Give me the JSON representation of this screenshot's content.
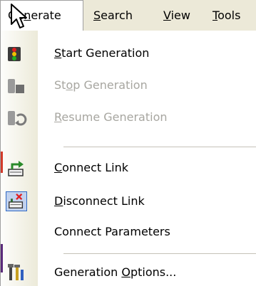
{
  "menubar": {
    "generate": {
      "pre": "Ge",
      "mn": "n",
      "post": "erate"
    },
    "search": {
      "pre": "",
      "mn": "S",
      "post": "earch"
    },
    "view": {
      "pre": "",
      "mn": "V",
      "post": "iew"
    },
    "tools": {
      "pre": "",
      "mn": "T",
      "post": "ools"
    }
  },
  "menu": {
    "start": {
      "pre": "",
      "mn": "S",
      "post": "tart Generation",
      "enabled": true,
      "icon": "traffic-light-icon"
    },
    "stop": {
      "pre": "St",
      "mn": "o",
      "post": "p Generation",
      "enabled": false,
      "icon": "stop-generation-icon"
    },
    "resume": {
      "pre": "",
      "mn": "R",
      "post": "esume Generation",
      "enabled": false,
      "icon": "resume-generation-icon"
    },
    "connect": {
      "pre": "",
      "mn": "C",
      "post": "onnect Link",
      "enabled": true,
      "icon": "connect-link-icon"
    },
    "disconnect": {
      "pre": "",
      "mn": "D",
      "post": "isconnect Link",
      "enabled": true,
      "icon": "disconnect-link-icon",
      "checked": true
    },
    "params": {
      "pre": "Connect Parameters",
      "mn": "",
      "post": "",
      "enabled": true
    },
    "options": {
      "pre": "Generation ",
      "mn": "O",
      "post": "ptions...",
      "enabled": true,
      "icon": "tools-icon"
    }
  },
  "colors": {
    "menubar_bg": "#ece9d8",
    "gutter_end": "#ecead9",
    "disabled_text": "#a7a6a0",
    "selected_icon_bg": "#c1d2ee",
    "selected_icon_border": "#316ac5"
  }
}
